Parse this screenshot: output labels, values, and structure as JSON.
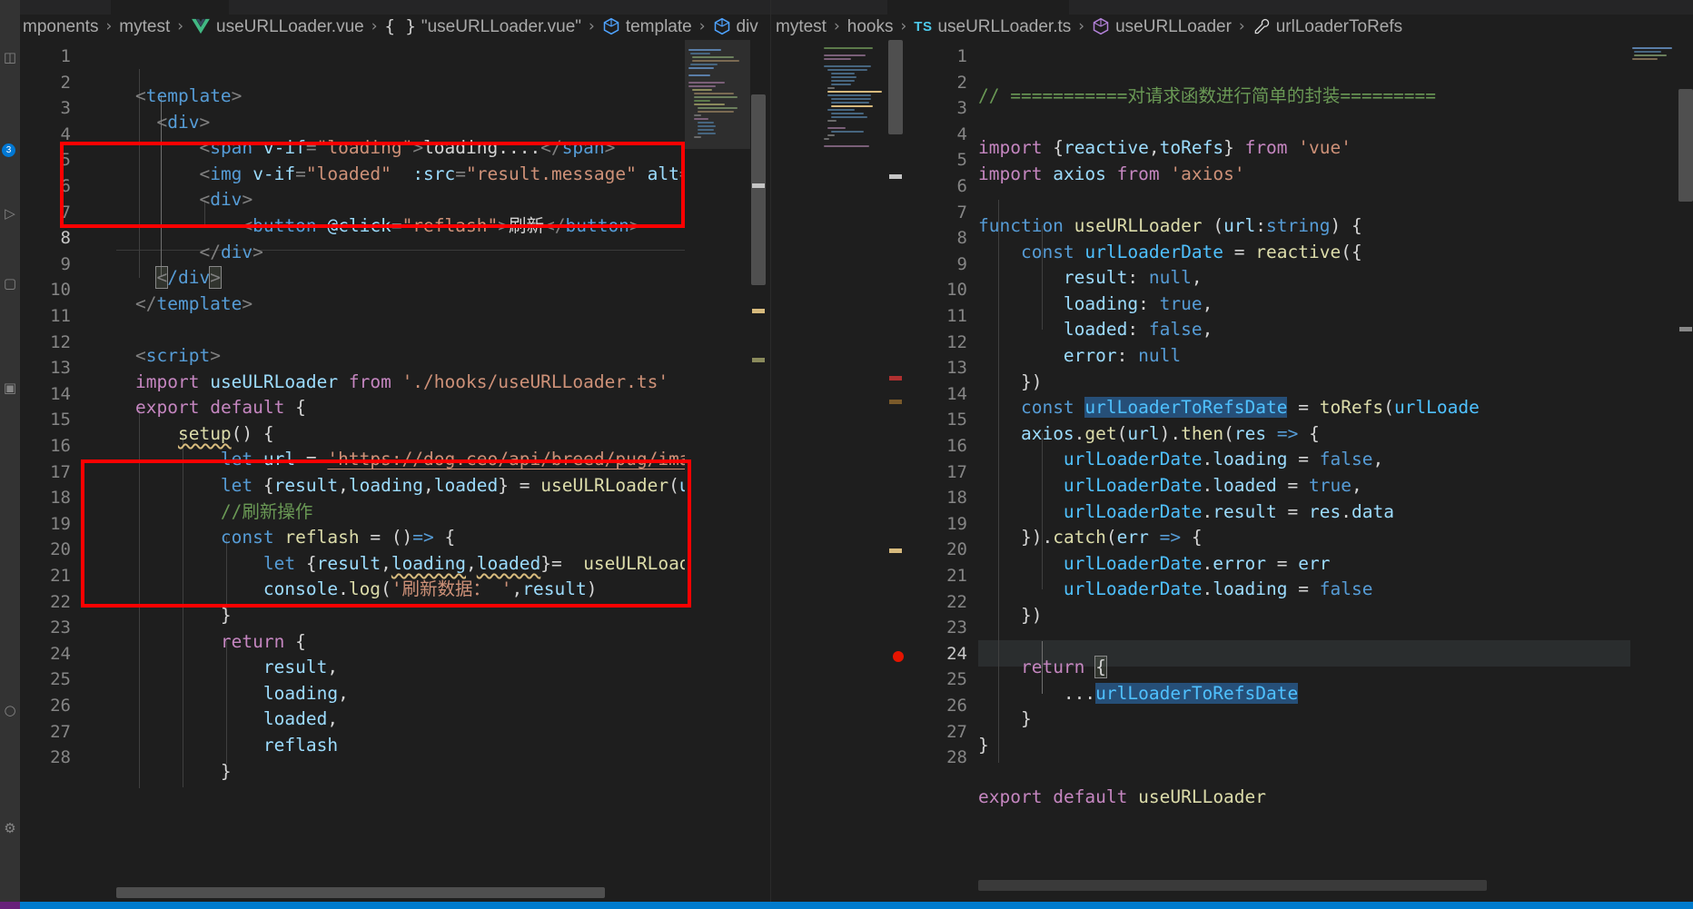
{
  "window": {
    "theme_background": "#1e1e1e",
    "accent_color": "#007acc",
    "annotation_color": "#ff0000"
  },
  "activity_bar": {
    "badge": "3",
    "icons": [
      "files-icon",
      "search-icon",
      "source-control-icon",
      "debug-icon",
      "extensions-icon",
      "account-icon",
      "gear-icon"
    ]
  },
  "breadcrumb_left": {
    "crumbs": [
      {
        "label": "mponents",
        "icon": ""
      },
      {
        "label": "mytest",
        "icon": ""
      },
      {
        "label": "useURLLoader.vue",
        "icon": "vue-icon"
      },
      {
        "label": "\"useURLLoader.vue\"",
        "icon": "braces-icon"
      },
      {
        "label": "template",
        "icon": "symbol-module-icon"
      },
      {
        "label": "div",
        "icon": "symbol-module-icon"
      }
    ],
    "separator": "›"
  },
  "breadcrumb_right": {
    "crumbs": [
      {
        "label": "mytest",
        "icon": ""
      },
      {
        "label": "hooks",
        "icon": ""
      },
      {
        "label": "useURLLoader.ts",
        "icon": "ts-icon"
      },
      {
        "label": "useURLLoader",
        "icon": "symbol-module-icon"
      },
      {
        "label": "urlLoaderToRefs",
        "icon": "symbol-wrench-icon"
      }
    ],
    "separator": "›"
  },
  "editor_left": {
    "file": "useURLLoader.vue",
    "language": "vue",
    "first_line_number": 1,
    "last_line_number": 28,
    "lines": [
      {
        "n": 1,
        "text": "<template>"
      },
      {
        "n": 2,
        "text": "  <div>"
      },
      {
        "n": 3,
        "text": "      <span v-if=\"loading\">loading....</span>"
      },
      {
        "n": 4,
        "text": "      <img v-if=\"loaded\" :src=\"result.message\" alt=\"\">"
      },
      {
        "n": 5,
        "text": "      <div>"
      },
      {
        "n": 6,
        "text": "          <button @click=\"reflash\">刷新</button>"
      },
      {
        "n": 7,
        "text": "      </div>"
      },
      {
        "n": 8,
        "text": "  </div>"
      },
      {
        "n": 9,
        "text": "</template>"
      },
      {
        "n": 10,
        "text": ""
      },
      {
        "n": 11,
        "text": "<script>"
      },
      {
        "n": 12,
        "text": "import useULRLoader from './hooks/useURLLoader.ts'"
      },
      {
        "n": 13,
        "text": "export default {"
      },
      {
        "n": 14,
        "text": "    setup() {"
      },
      {
        "n": 15,
        "text": "        let url = 'https://dog.ceo/api/breed/pug/images"
      },
      {
        "n": 16,
        "text": "        let {result,loading,loaded} = useULRLoader(url)"
      },
      {
        "n": 17,
        "text": "        //刷新操作"
      },
      {
        "n": 18,
        "text": "        const reflash = ()=> {"
      },
      {
        "n": 19,
        "text": "            let {result,loading,loaded}=  useULRLoader("
      },
      {
        "n": 20,
        "text": "            console.log('刷新数据： ',result)"
      },
      {
        "n": 21,
        "text": "        }"
      },
      {
        "n": 22,
        "text": "        return {"
      },
      {
        "n": 23,
        "text": "            result,"
      },
      {
        "n": 24,
        "text": "            loading,"
      },
      {
        "n": 25,
        "text": "            loaded,"
      },
      {
        "n": 26,
        "text": "            reflash"
      },
      {
        "n": 27,
        "text": "        }"
      },
      {
        "n": 28,
        "text": ""
      }
    ]
  },
  "editor_right": {
    "file": "useURLLoader.ts",
    "language": "typescript",
    "first_line_number": 1,
    "last_line_number": 28,
    "breakpoint_line": 24,
    "selected_text": "urlLoaderToRefsDate",
    "lines": [
      {
        "n": 1,
        "text": "// ===========对请求函数进行简单的封装========="
      },
      {
        "n": 2,
        "text": ""
      },
      {
        "n": 3,
        "text": "import {reactive,toRefs} from 'vue'"
      },
      {
        "n": 4,
        "text": "import axios from 'axios'"
      },
      {
        "n": 5,
        "text": ""
      },
      {
        "n": 6,
        "text": "function useURLLoader (url:string) {"
      },
      {
        "n": 7,
        "text": "    const urlLoaderDate = reactive({"
      },
      {
        "n": 8,
        "text": "        result: null,"
      },
      {
        "n": 9,
        "text": "        loading: true,"
      },
      {
        "n": 10,
        "text": "        loaded: false,"
      },
      {
        "n": 11,
        "text": "        error: null"
      },
      {
        "n": 12,
        "text": "    })"
      },
      {
        "n": 13,
        "text": "    const urlLoaderToRefsDate = toRefs(urlLoade"
      },
      {
        "n": 14,
        "text": "    axios.get(url).then(res => {"
      },
      {
        "n": 15,
        "text": "        urlLoaderDate.loading = false,"
      },
      {
        "n": 16,
        "text": "        urlLoaderDate.loaded = true,"
      },
      {
        "n": 17,
        "text": "        urlLoaderDate.result = res.data"
      },
      {
        "n": 18,
        "text": "    }).catch(err => {"
      },
      {
        "n": 19,
        "text": "        urlLoaderDate.error = err"
      },
      {
        "n": 20,
        "text": "        urlLoaderDate.loading = false"
      },
      {
        "n": 21,
        "text": "    })"
      },
      {
        "n": 22,
        "text": ""
      },
      {
        "n": 23,
        "text": "    return {"
      },
      {
        "n": 24,
        "text": "        ...urlLoaderToRefsDate"
      },
      {
        "n": 25,
        "text": "    }"
      },
      {
        "n": 26,
        "text": "}"
      },
      {
        "n": 27,
        "text": ""
      },
      {
        "n": 28,
        "text": "export default useURLLoader"
      }
    ]
  },
  "annotations": [
    {
      "name": "red-highlight-template-div",
      "pane": "left",
      "lines": "5-7"
    },
    {
      "name": "red-highlight-reflash-function",
      "pane": "left",
      "lines": "17-21"
    }
  ]
}
